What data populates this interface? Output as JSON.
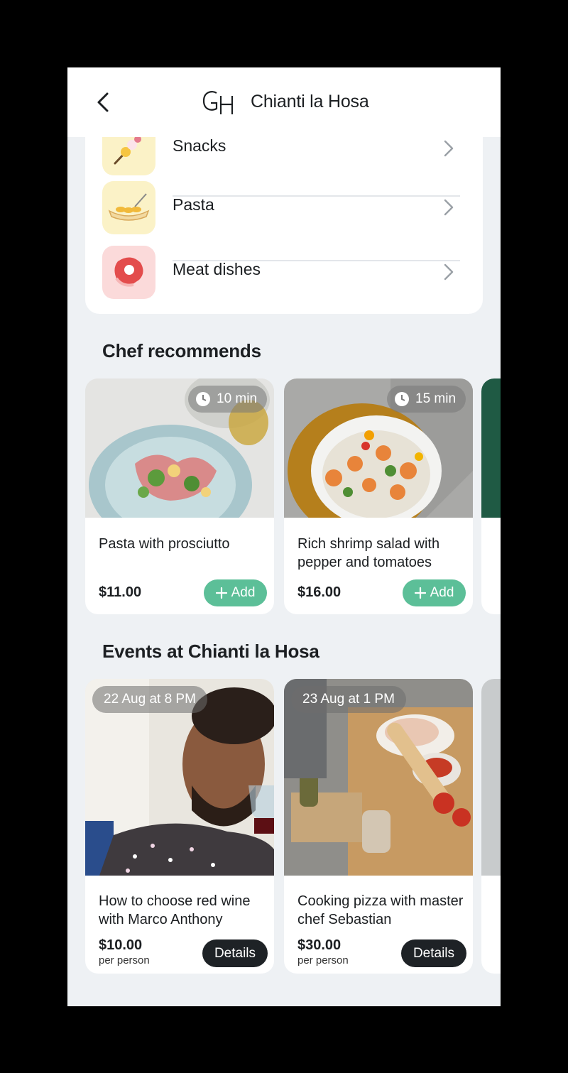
{
  "header": {
    "title": "Chianti la Hosa",
    "logo_text": "GH"
  },
  "categories": [
    {
      "label": "Snacks",
      "icon": "snack-skewer-icon"
    },
    {
      "label": "Pasta",
      "icon": "pasta-dish-icon"
    },
    {
      "label": "Meat dishes",
      "icon": "steak-icon"
    }
  ],
  "chef_section": {
    "title": "Chef recommends",
    "dishes": [
      {
        "name": "Pasta with prosciutto",
        "price": "$11.00",
        "time": "10 min",
        "add_label": "Add"
      },
      {
        "name": "Rich shrimp salad with pepper and tomatoes",
        "price": "$16.00",
        "time": "15 min",
        "add_label": "Add"
      }
    ]
  },
  "events_section": {
    "title": "Events at Chianti la Hosa",
    "events": [
      {
        "date": "22 Aug at 8 PM",
        "name": "How to choose red wine with Marco Anthony",
        "price": "$10.00",
        "unit": "per person",
        "button": "Details"
      },
      {
        "date": "23 Aug at 1 PM",
        "name": "Cooking pizza with master chef Sebastian",
        "price": "$30.00",
        "unit": "per person",
        "button": "Details"
      }
    ]
  },
  "colors": {
    "accent_green": "#5cbf98",
    "dark_button": "#1e2226",
    "background": "#eef1f4"
  }
}
